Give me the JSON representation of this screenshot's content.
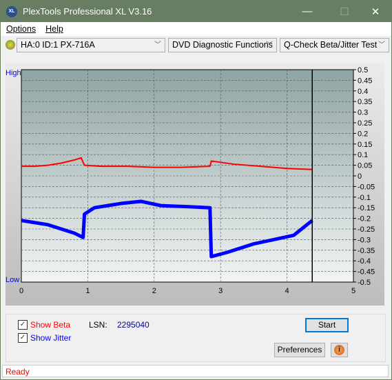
{
  "window": {
    "title": "PlexTools Professional XL V3.16",
    "logo": "XL"
  },
  "menu": {
    "items": [
      "Options",
      "Help"
    ]
  },
  "toolbar": {
    "drive": "HA:0 ID:1  PX-716A",
    "function": "DVD Diagnostic Functions",
    "test": "Q-Check Beta/Jitter Test"
  },
  "chart_data": {
    "type": "line",
    "xlim": [
      0,
      5
    ],
    "ylim": [
      -0.5,
      0.5
    ],
    "x_ticks": [
      "0",
      "1",
      "2",
      "3",
      "4",
      "5"
    ],
    "y_ticks": [
      "0.5",
      "0.45",
      "0.4",
      "0.35",
      "0.3",
      "0.25",
      "0.2",
      "0.15",
      "0.1",
      "0.05",
      "0",
      "-0.05",
      "-0.1",
      "-0.15",
      "-0.2",
      "-0.25",
      "-0.3",
      "-0.35",
      "-0.4",
      "-0.45",
      "-0.5"
    ],
    "left_labels": {
      "top": "High",
      "bottom": "Low"
    },
    "grid": true,
    "cursor_x": 4.38,
    "series": [
      {
        "name": "Beta",
        "color": "#ff0000",
        "points": [
          [
            0,
            0.045
          ],
          [
            0.2,
            0.045
          ],
          [
            0.4,
            0.05
          ],
          [
            0.6,
            0.06
          ],
          [
            0.8,
            0.075
          ],
          [
            0.9,
            0.085
          ],
          [
            0.95,
            0.05
          ],
          [
            1.2,
            0.045
          ],
          [
            1.6,
            0.045
          ],
          [
            2,
            0.04
          ],
          [
            2.4,
            0.04
          ],
          [
            2.84,
            0.045
          ],
          [
            2.86,
            0.07
          ],
          [
            3.2,
            0.055
          ],
          [
            3.6,
            0.045
          ],
          [
            4.0,
            0.035
          ],
          [
            4.38,
            0.03
          ]
        ]
      },
      {
        "name": "Jitter",
        "color": "#0000ff",
        "points": [
          [
            0,
            -0.21
          ],
          [
            0.2,
            -0.22
          ],
          [
            0.4,
            -0.23
          ],
          [
            0.6,
            -0.25
          ],
          [
            0.8,
            -0.27
          ],
          [
            0.93,
            -0.29
          ],
          [
            0.95,
            -0.18
          ],
          [
            1.1,
            -0.15
          ],
          [
            1.3,
            -0.14
          ],
          [
            1.5,
            -0.13
          ],
          [
            1.8,
            -0.12
          ],
          [
            2.1,
            -0.14
          ],
          [
            2.5,
            -0.145
          ],
          [
            2.84,
            -0.15
          ],
          [
            2.86,
            -0.38
          ],
          [
            3.1,
            -0.36
          ],
          [
            3.5,
            -0.32
          ],
          [
            3.8,
            -0.3
          ],
          [
            4.1,
            -0.28
          ],
          [
            4.38,
            -0.21
          ]
        ]
      }
    ]
  },
  "controls": {
    "show_beta": "Show Beta",
    "show_jitter": "Show Jitter",
    "beta_checked": true,
    "jitter_checked": true,
    "lsn_label": "LSN:",
    "lsn_value": "2295040",
    "start": "Start",
    "preferences": "Preferences"
  },
  "status": "Ready"
}
